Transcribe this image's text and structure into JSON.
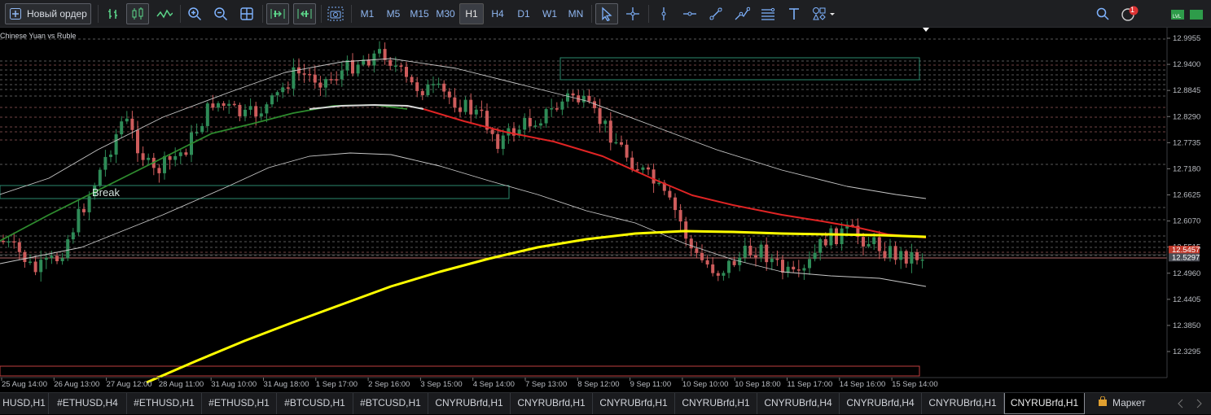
{
  "toolbar": {
    "new_order_label": "Новый ордер",
    "timeframes": [
      "M1",
      "M5",
      "M15",
      "M30",
      "H1",
      "H4",
      "D1",
      "W1",
      "MN"
    ],
    "active_timeframe": "H1",
    "notification_count": "1"
  },
  "chart": {
    "symbol_title": "Chinese Yuan vs Ruble",
    "break_label": "Break",
    "colors": {
      "bull": "#2e8b57",
      "bear": "#cd5c5c",
      "ma_yellow": "#ffff00",
      "ma_red": "#e02424",
      "ma_green": "#2e8b2e",
      "band": "#c8c8c8",
      "level_red": "#c97a7a",
      "level_white": "#9a9a9a",
      "box_green": "#2d8a6e"
    },
    "price_axis": [
      "12.9955",
      "12.9400",
      "12.8845",
      "12.8290",
      "12.7735",
      "12.7180",
      "12.6625",
      "12.6070",
      "12.5515",
      "12.4960",
      "12.4405",
      "12.3850",
      "12.3295"
    ],
    "price_labels": {
      "ask": "12.5457",
      "bid": "12.5297"
    },
    "time_axis": [
      "25 Aug 14:00",
      "26 Aug 13:00",
      "27 Aug 12:00",
      "28 Aug 11:00",
      "31 Aug 10:00",
      "31 Aug 18:00",
      "1 Sep 17:00",
      "2 Sep 16:00",
      "3 Sep 15:00",
      "4 Sep 14:00",
      "7 Sep 13:00",
      "8 Sep 12:00",
      "9 Sep 11:00",
      "10 Sep 10:00",
      "10 Sep 18:00",
      "11 Sep 17:00",
      "14 Sep 16:00",
      "15 Sep 14:00"
    ]
  },
  "tabs": [
    "HUSD,H1",
    "#ETHUSD,H4",
    "#ETHUSD,H1",
    "#ETHUSD,H1",
    "#BTCUSD,H1",
    "#BTCUSD,H1",
    "CNYRUBrfd,H1",
    "CNYRUBrfd,H1",
    "CNYRUBrfd,H1",
    "CNYRUBrfd,H1",
    "CNYRUBrfd,H4",
    "CNYRUBrfd,H4",
    "CNYRUBrfd,H1",
    "CNYRUBrfd,H1"
  ],
  "active_tab_index": 13,
  "market_label": "Маркет"
}
